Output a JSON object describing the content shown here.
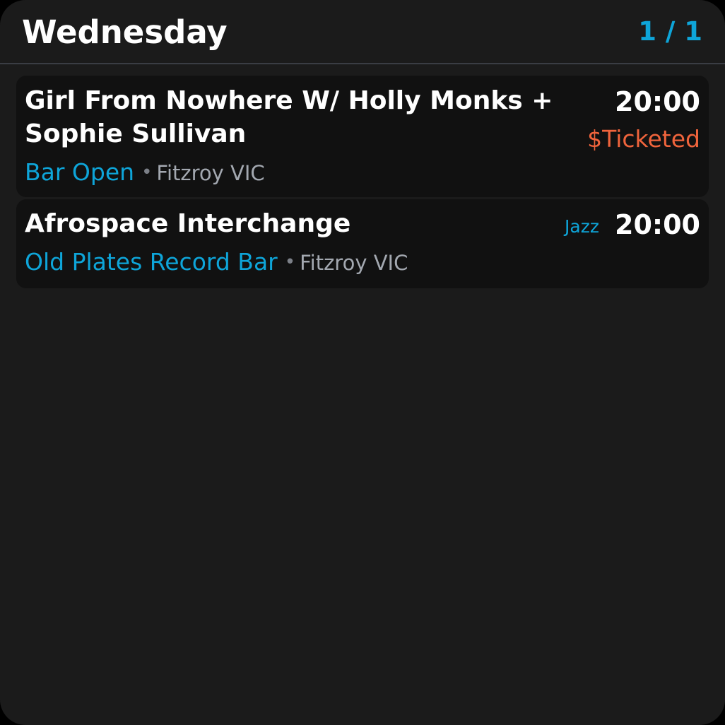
{
  "header": {
    "day": "Wednesday",
    "page_indicator": "1 / 1"
  },
  "events": [
    {
      "title": "Girl From Nowhere W/ Holly Monks + Sophie Sullivan",
      "time": "20:00",
      "ticket": "$Ticketed",
      "venue": "Bar Open",
      "separator": "•",
      "location": "Fitzroy VIC"
    },
    {
      "title": "Afrospace Interchange",
      "time": "20:00",
      "genre": "Jazz",
      "venue": "Old Plates Record Bar",
      "separator": "•",
      "location": "Fitzroy VIC"
    }
  ],
  "colors": {
    "background": "#1b1b1b",
    "card": "#111111",
    "accent": "#0ea5d9",
    "ticket": "#f0643c",
    "muted": "#a3a8b0",
    "divider": "#3a3d44"
  }
}
